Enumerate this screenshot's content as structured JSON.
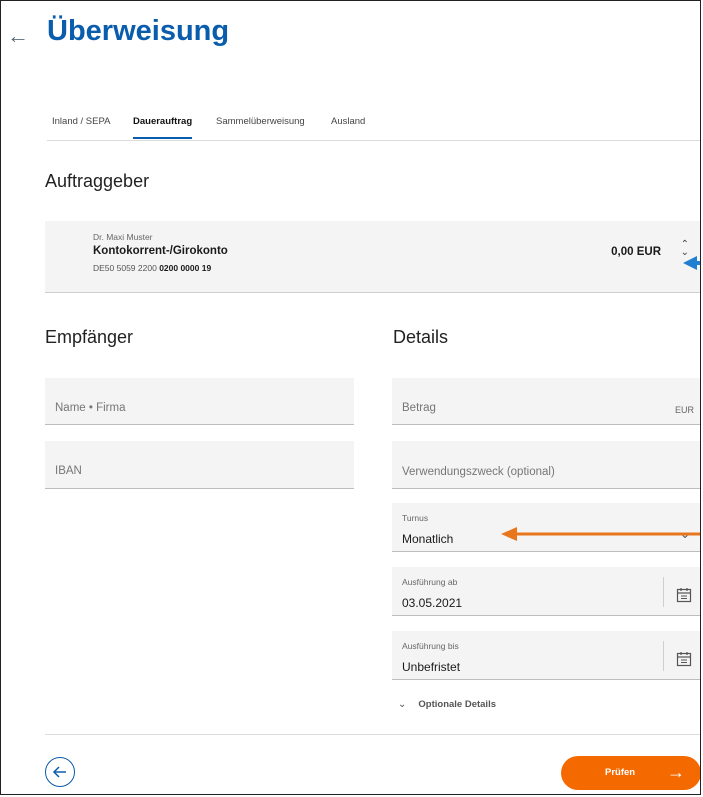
{
  "header": {
    "back_icon": "back-arrow-icon",
    "title": "Überweisung"
  },
  "tabs": [
    {
      "label": "Inland / SEPA",
      "active": false
    },
    {
      "label": "Dauerauftrag",
      "active": true
    },
    {
      "label": "Sammelüberweisung",
      "active": false
    },
    {
      "label": "Ausland",
      "active": false
    }
  ],
  "auftraggeber": {
    "heading": "Auftraggeber",
    "owner": "Dr. Maxi Muster",
    "account_name": "Kontokorrent-/Girokonto",
    "iban_prefix": "DE50 5059 2200",
    "iban_suffix": "0200 0000 19",
    "balance": "0,00 EUR"
  },
  "empfaenger": {
    "heading": "Empfänger",
    "name_placeholder": "Name • Firma",
    "iban_placeholder": "IBAN"
  },
  "details": {
    "heading": "Details",
    "betrag_placeholder": "Betrag",
    "currency": "EUR",
    "verwendungszweck_placeholder": "Verwendungszweck (optional)",
    "turnus_label": "Turnus",
    "turnus_value": "Monatlich",
    "ausfuehrung_ab_label": "Ausführung ab",
    "ausfuehrung_ab_value": "03.05.2021",
    "ausfuehrung_bis_label": "Ausführung bis",
    "ausfuehrung_bis_value": "Unbefristet",
    "optional_details": "Optionale Details"
  },
  "footer": {
    "submit_label": "Prüfen"
  },
  "colors": {
    "brand_blue": "#0a5cad",
    "accent_orange": "#f56a00",
    "annotation_blue": "#1f7fd1",
    "annotation_orange": "#e8761c"
  }
}
